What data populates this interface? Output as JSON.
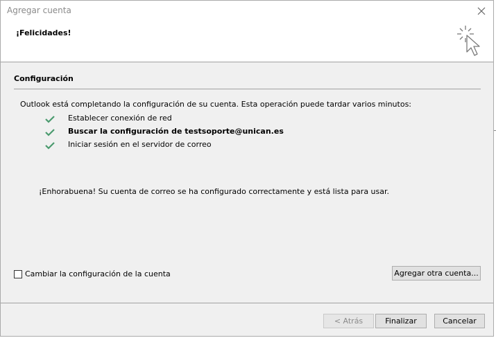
{
  "window": {
    "title": "Agregar cuenta"
  },
  "header": {
    "title": "¡Felicidades!"
  },
  "section": {
    "label": "Configuración",
    "intro": "Outlook está completando la configuración de su cuenta. Esta operación puede tardar varios minutos:",
    "steps": [
      {
        "label": "Establecer conexión de red",
        "status": "done"
      },
      {
        "label": "Buscar la configuración de testsoporte@unican.es",
        "status": "done"
      },
      {
        "label": "Iniciar sesión en el servidor de correo",
        "status": "done"
      }
    ],
    "congrats": "¡Enhorabuena! Su cuenta de correo se ha configurado correctamente y está lista para usar."
  },
  "options": {
    "change_settings_label": "Cambiar la configuración de la cuenta",
    "change_settings_checked": false,
    "add_another_label": "Agregar otra cuenta..."
  },
  "footer": {
    "back_label": "< Atrás",
    "finish_label": "Finalizar",
    "cancel_label": "Cancelar"
  },
  "colors": {
    "check": "#4a9a6e",
    "sparkle": "#7a7a7a"
  },
  "icons": {
    "step": "checkmark-icon",
    "header": "sparkle-cursor-icon",
    "close": "close-icon"
  }
}
